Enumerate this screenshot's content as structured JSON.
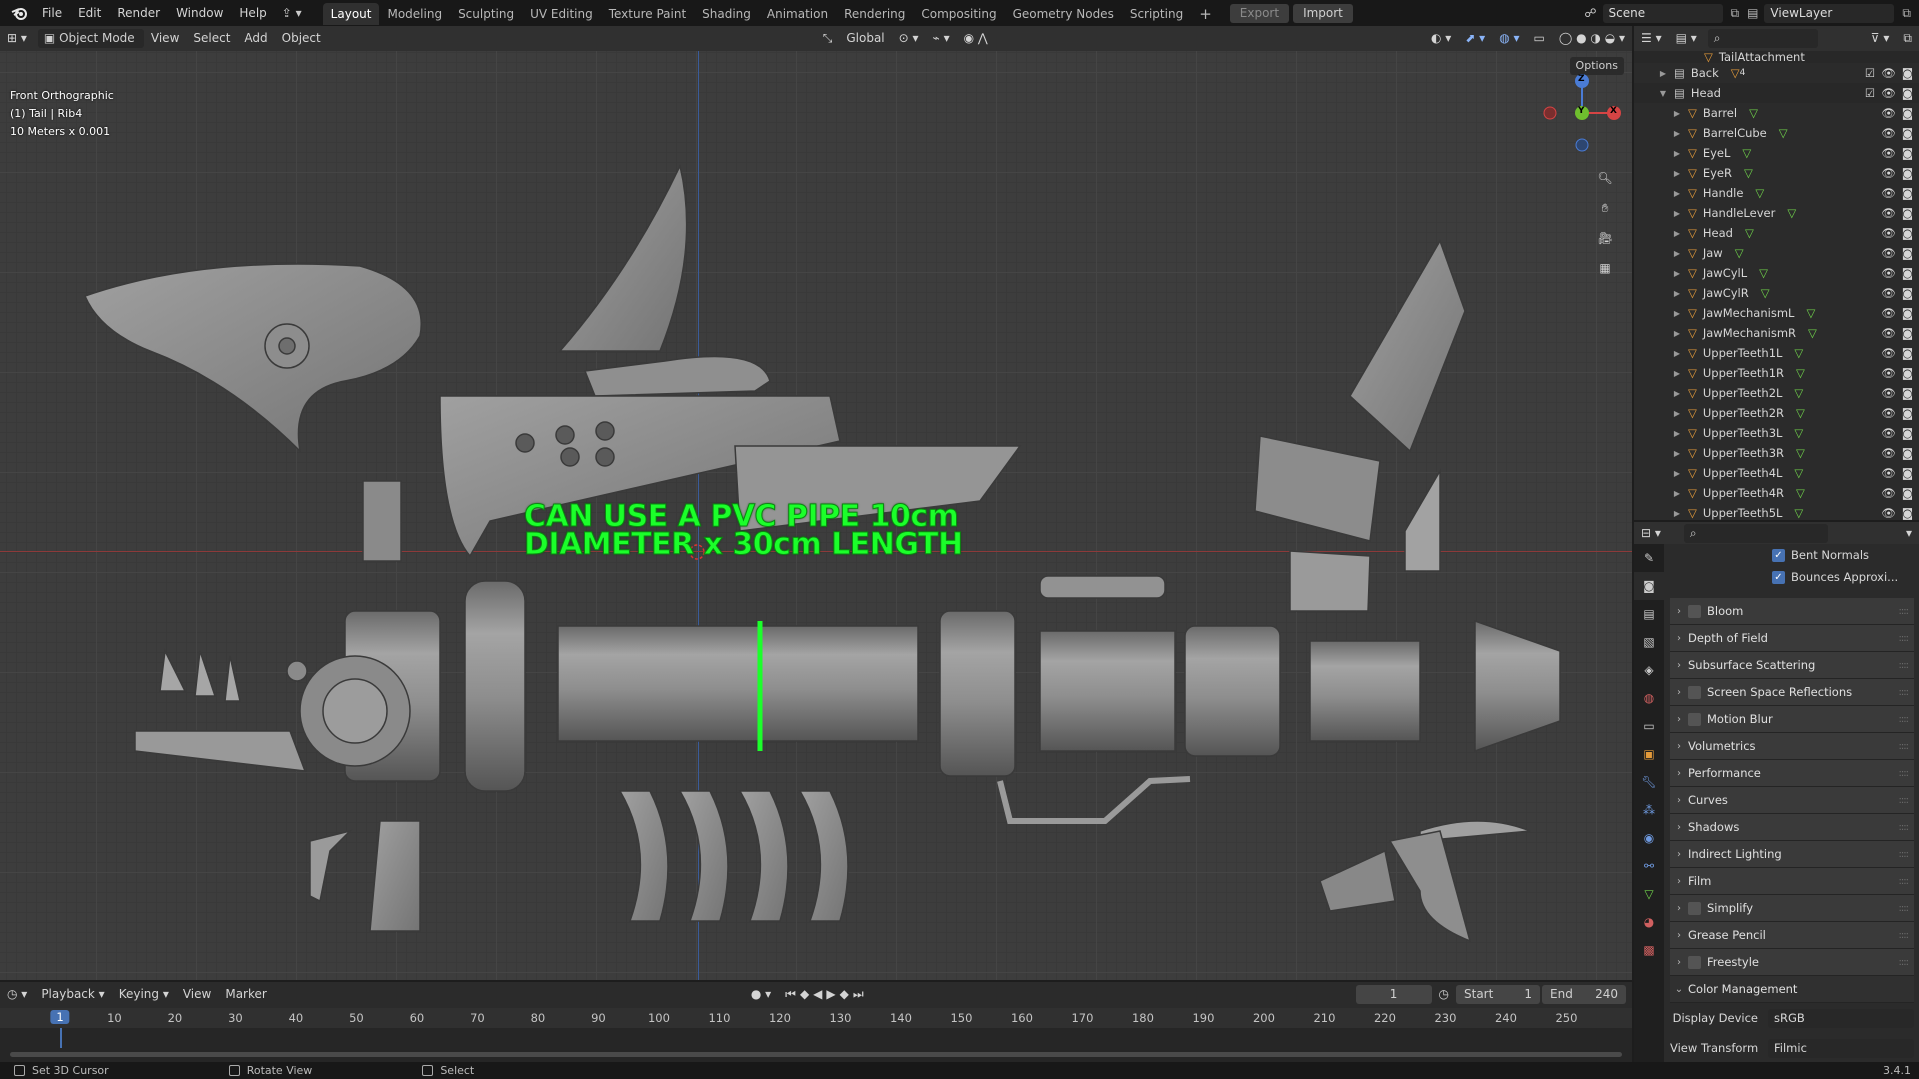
{
  "topbar": {
    "menus": [
      "File",
      "Edit",
      "Render",
      "Window",
      "Help"
    ],
    "workspaces": [
      "Layout",
      "Modeling",
      "Sculpting",
      "UV Editing",
      "Texture Paint",
      "Shading",
      "Animation",
      "Rendering",
      "Compositing",
      "Geometry Nodes",
      "Scripting"
    ],
    "active_workspace": "Layout",
    "add_tab": "+",
    "export_label": "Export",
    "import_label": "Import",
    "scene": "Scene",
    "view_layer": "ViewLayer"
  },
  "viewport_header": {
    "mode": "Object Mode",
    "menus": [
      "View",
      "Select",
      "Add",
      "Object"
    ],
    "orientation": "Global",
    "options_label": "Options"
  },
  "viewport": {
    "view_name": "Front Orthographic",
    "selection": "(1) Tail | Rib4",
    "scale": "10 Meters x 0.001",
    "annotation_line1": "CAN USE A PVC PIPE 10cm",
    "annotation_line2": "DIAMETER x 30cm LENGTH",
    "gizmo": {
      "z": "Z",
      "y": "Y",
      "x": "X"
    },
    "accent": "#1bff2a"
  },
  "outliner": {
    "top_item": "TailAttachment",
    "back": {
      "name": "Back",
      "child_count": "4"
    },
    "head": "Head",
    "children": [
      "Barrel",
      "BarrelCube",
      "EyeL",
      "EyeR",
      "Handle",
      "HandleLever",
      "Head",
      "Jaw",
      "JawCylL",
      "JawCylR",
      "JawMechanismL",
      "JawMechanismR",
      "UpperTeeth1L",
      "UpperTeeth1R",
      "UpperTeeth2L",
      "UpperTeeth2R",
      "UpperTeeth3L",
      "UpperTeeth3R",
      "UpperTeeth4L",
      "UpperTeeth4R",
      "UpperTeeth5L"
    ]
  },
  "properties": {
    "checks": [
      {
        "label": "Bent Normals",
        "checked": true
      },
      {
        "label": "Bounces Approxi...",
        "checked": true
      }
    ],
    "panels": [
      {
        "label": "Bloom",
        "checkbox": true
      },
      {
        "label": "Depth of Field",
        "checkbox": false
      },
      {
        "label": "Subsurface Scattering",
        "checkbox": false
      },
      {
        "label": "Screen Space Reflections",
        "checkbox": true
      },
      {
        "label": "Motion Blur",
        "checkbox": true
      },
      {
        "label": "Volumetrics",
        "checkbox": false
      },
      {
        "label": "Performance",
        "checkbox": false
      },
      {
        "label": "Curves",
        "checkbox": false
      },
      {
        "label": "Shadows",
        "checkbox": false
      },
      {
        "label": "Indirect Lighting",
        "checkbox": false
      },
      {
        "label": "Film",
        "checkbox": false
      },
      {
        "label": "Simplify",
        "checkbox": true
      },
      {
        "label": "Grease Pencil",
        "checkbox": false
      },
      {
        "label": "Freestyle",
        "checkbox": true
      }
    ],
    "color_management": {
      "label": "Color Management",
      "display_device_label": "Display Device",
      "display_device": "sRGB",
      "view_transform_label": "View Transform",
      "view_transform": "Filmic"
    }
  },
  "timeline": {
    "menus": [
      "Playback",
      "Keying",
      "View",
      "Marker"
    ],
    "current_frame": "1",
    "start_label": "Start",
    "start": "1",
    "end_label": "End",
    "end": "240",
    "ticks": [
      "1",
      "10",
      "20",
      "30",
      "40",
      "50",
      "60",
      "70",
      "80",
      "90",
      "100",
      "110",
      "120",
      "130",
      "140",
      "150",
      "160",
      "170",
      "180",
      "190",
      "200",
      "210",
      "220",
      "230",
      "240",
      "250"
    ]
  },
  "statusbar": {
    "item1": "Set 3D Cursor",
    "item2": "Rotate View",
    "item3": "Select",
    "version": "3.4.1"
  }
}
